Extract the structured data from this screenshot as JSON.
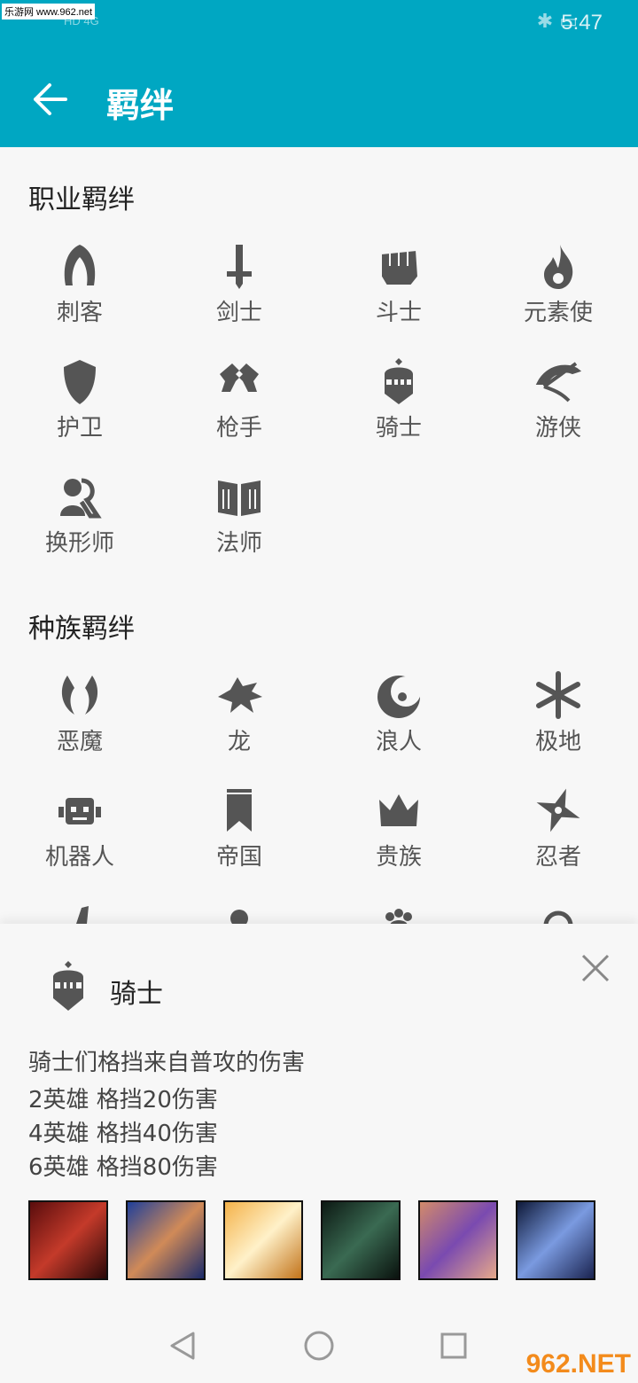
{
  "status_bar": {
    "watermark": "乐游网 www.962.net",
    "network": "HD 4G",
    "time": "5:47"
  },
  "header": {
    "title": "羁绊"
  },
  "class_section": {
    "title": "职业羁绊",
    "items": [
      {
        "label": "刺客",
        "icon": "assassin-hood-icon"
      },
      {
        "label": "剑士",
        "icon": "sword-icon"
      },
      {
        "label": "斗士",
        "icon": "fist-icon"
      },
      {
        "label": "元素使",
        "icon": "flame-icon"
      },
      {
        "label": "护卫",
        "icon": "shield-icon"
      },
      {
        "label": "枪手",
        "icon": "crossed-pistols-icon"
      },
      {
        "label": "骑士",
        "icon": "knight-helmet-icon"
      },
      {
        "label": "游侠",
        "icon": "bow-icon"
      },
      {
        "label": "换形师",
        "icon": "shapeshifter-icon"
      },
      {
        "label": "法师",
        "icon": "book-icon"
      }
    ]
  },
  "origin_section": {
    "title": "种族羁绊",
    "items": [
      {
        "label": "恶魔",
        "icon": "demon-horns-icon"
      },
      {
        "label": "龙",
        "icon": "dragon-icon"
      },
      {
        "label": "浪人",
        "icon": "exile-crescent-icon"
      },
      {
        "label": "极地",
        "icon": "snowflake-icon"
      },
      {
        "label": "机器人",
        "icon": "robot-icon"
      },
      {
        "label": "帝国",
        "icon": "banner-icon"
      },
      {
        "label": "贵族",
        "icon": "crown-icon"
      },
      {
        "label": "忍者",
        "icon": "shuriken-icon"
      }
    ]
  },
  "detail_panel": {
    "name": "骑士",
    "icon": "knight-helmet-icon",
    "description": "骑士们格挡来自普攻的伤害",
    "effects": [
      "2英雄 格挡20伤害",
      "4英雄 格挡40伤害",
      "6英雄 格挡80伤害"
    ],
    "heroes": [
      "hero-portrait-1",
      "hero-portrait-2",
      "hero-portrait-3",
      "hero-portrait-4",
      "hero-portrait-5",
      "hero-portrait-6"
    ]
  },
  "watermark": {
    "brand": "962.NET",
    "sub": "乐游网"
  },
  "colors": {
    "appbar": "#00a7c2",
    "icon": "#555555"
  }
}
